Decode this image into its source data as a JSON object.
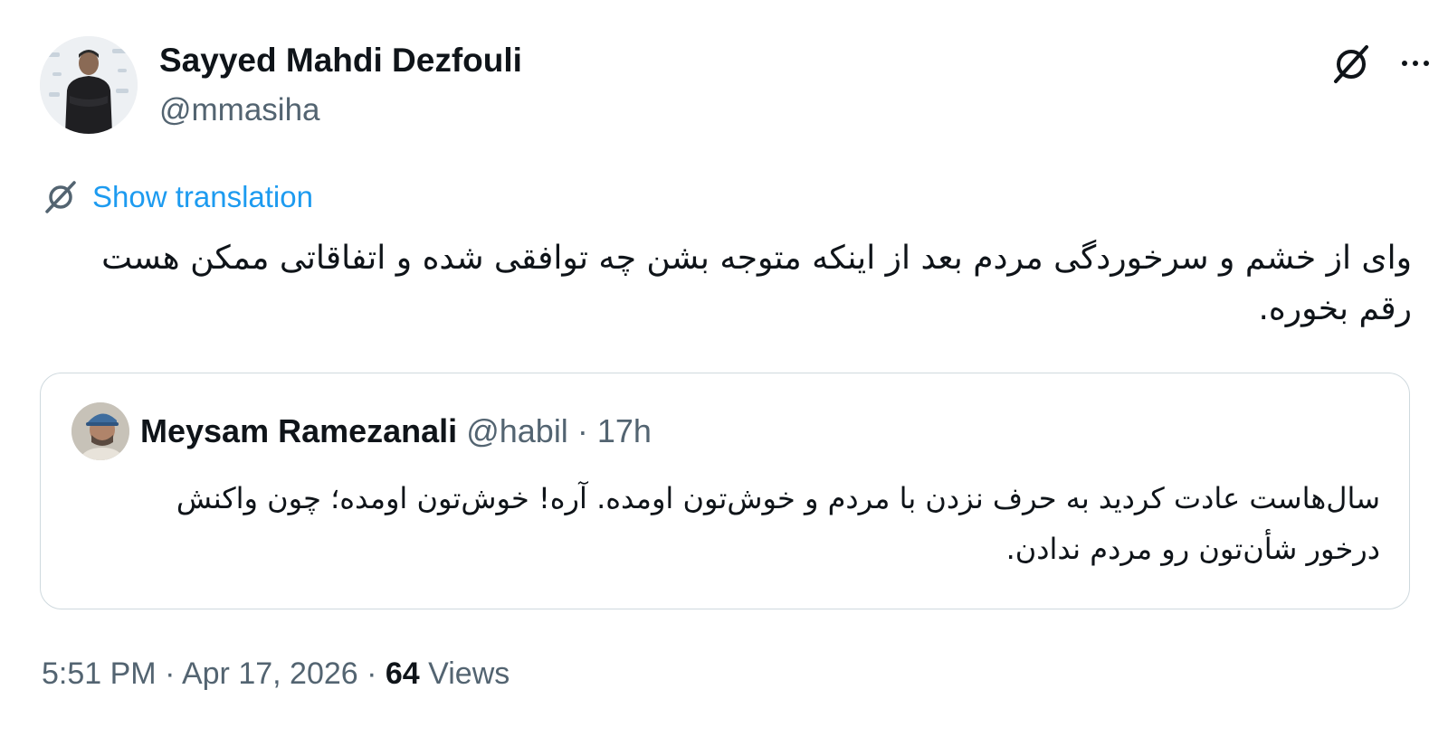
{
  "author": {
    "name": "Sayyed Mahdi Dezfouli",
    "handle": "@mmasiha"
  },
  "icons": {
    "grok": "grok-slash-icon",
    "more": "more-horizontal-icon",
    "translate": "grok-slash-icon"
  },
  "translation": {
    "label": "Show translation"
  },
  "tweet": {
    "text": "وای از خشم و سرخوردگی مردم بعد از اینکه متوجه بشن چه توافقی شده و اتفاقاتی ممکن هست رقم بخوره."
  },
  "quote": {
    "name": "Meysam Ramezanali",
    "handle": "@habil",
    "separator": " · ",
    "time": "17h",
    "text": "سال‌هاست عادت کردید به حرف نزدن با مردم و خوش‌تون اومده. آره! خوش‌تون اومده؛ چون واکنش درخور شأن‌تون رو مردم ندادن."
  },
  "meta": {
    "time": "5:51 PM",
    "separator": " · ",
    "date": "Apr 17, 2026",
    "views_count": "64",
    "views_label": " Views"
  },
  "colors": {
    "link": "#1d9bf0",
    "secondary_text": "#536471",
    "primary_text": "#0f1419",
    "border": "#cfd9de"
  }
}
